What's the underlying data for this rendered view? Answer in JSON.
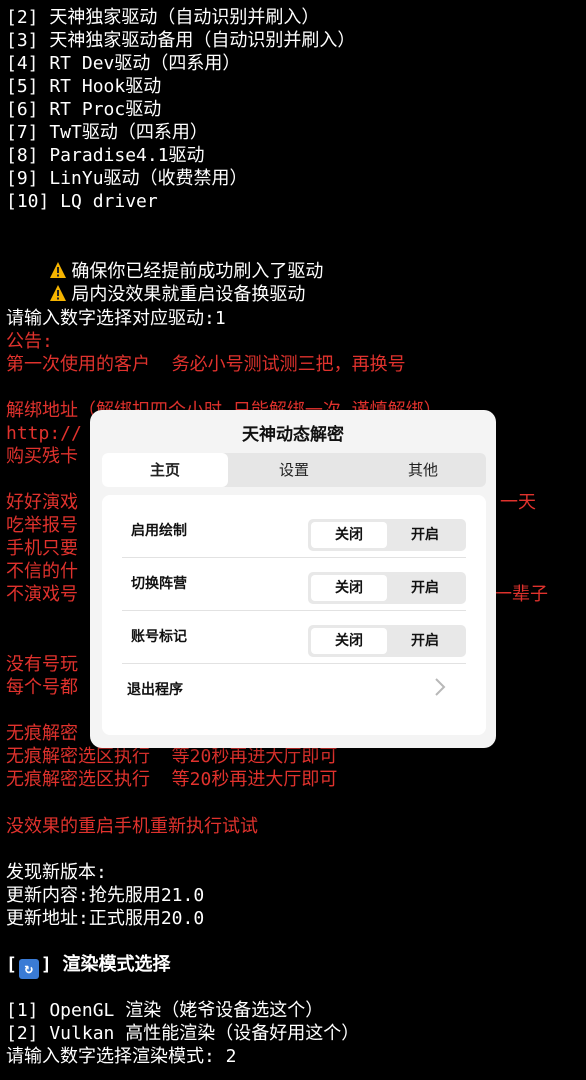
{
  "terminal": {
    "lines": [
      "[2] 天神独家驱动（自动识别并刷入）",
      "[3] 天神独家驱动备用（自动识别并刷入）",
      "[4] RT Dev驱动（四系用）",
      "[5] RT Hook驱动",
      "[6] RT Proc驱动",
      "[7] TwT驱动（四系用）",
      "[8] Paradise4.1驱动",
      "[9] LinYu驱动（收费禁用）",
      "[10] LQ driver"
    ],
    "warnings": [
      "确保你已经提前成功刷入了驱动",
      "局内没效果就重启设备换驱动"
    ],
    "prompt_driver": "请输入数字选择对应驱动:1",
    "announce_title": "公告:",
    "announce_1": "第一次使用的客户  务必小号测试测三把，再换号",
    "unbind_line": "解绑地址（解绑扣四个小时 只能解绑一次 谨慎解绑）",
    "url_partial": "http://",
    "buy_partial": "购买残卡",
    "warn_red_1a": "好好演戏",
    "warn_red_1b": "一天",
    "warn_red_2": "吃举报号",
    "warn_red_3": "手机只要",
    "warn_red_4": "不信的什",
    "warn_red_5a": "不演戏号",
    "warn_red_5b": "一辈子",
    "noacct_1": "没有号玩",
    "noacct_2": "每个号都",
    "trace_partial": "无痕解密",
    "trace_full": "无痕解密选区执行  等20秒再进大厅即可",
    "restart_line": "没效果的重启手机重新执行试试",
    "new_version": "发现新版本:",
    "update_content": "更新内容:抢先服用21.0",
    "update_address": "更新地址:正式服用20.0",
    "render_header": "渲染模式选择",
    "render_opt_1": "[1] OpenGL 渲染（姥爷设备选这个）",
    "render_opt_2": "[2] Vulkan 高性能渲染（设备好用这个）",
    "prompt_render": "请输入数字选择渲染模式: 2"
  },
  "dialog": {
    "title": "天神动态解密",
    "tabs": [
      "主页",
      "设置",
      "其他"
    ],
    "rows": [
      {
        "label": "启用绘制",
        "off": "关闭",
        "on": "开启"
      },
      {
        "label": "切换阵营",
        "off": "关闭",
        "on": "开启"
      },
      {
        "label": "账号标记",
        "off": "关闭",
        "on": "开启"
      }
    ],
    "exit_label": "退出程序"
  },
  "colors": {
    "background": "#000000",
    "text": "#ffffff",
    "red": "#e0322d",
    "dialog_bg": "#f4f4f4"
  }
}
